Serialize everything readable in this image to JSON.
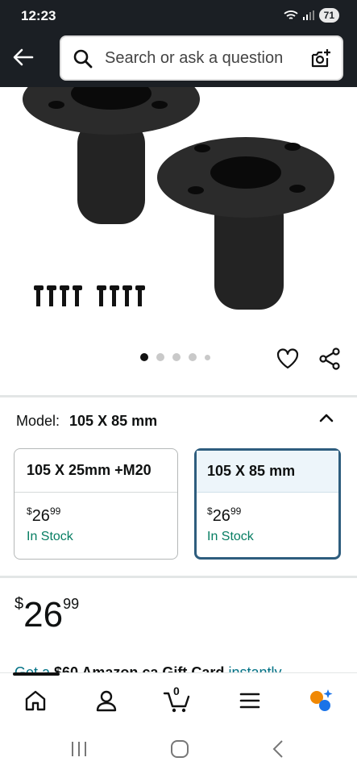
{
  "status_bar": {
    "time": "12:23",
    "battery": "71"
  },
  "search": {
    "placeholder": "Search or ask a question"
  },
  "gallery": {
    "image_count": 5,
    "active_index": 0
  },
  "variant": {
    "label": "Model:",
    "selected": "105 X 85 mm",
    "options": [
      {
        "name": "105 X 25mm +M20",
        "currency": "$",
        "price_whole": "26",
        "price_cents": "99",
        "stock": "In Stock"
      },
      {
        "name": "105 X 85 mm",
        "currency": "$",
        "price_whole": "26",
        "price_cents": "99",
        "stock": "In Stock"
      }
    ]
  },
  "price": {
    "currency": "$",
    "whole": "26",
    "cents": "99"
  },
  "promo": {
    "prefix": "Get a ",
    "amount": "$60 Amazon.ca Gift Card",
    "suffix": " instantly"
  },
  "bottom_nav": {
    "cart_count": "0"
  },
  "colors": {
    "header_bg": "#1b1f24",
    "selected_border": "#2e5d7e",
    "in_stock": "#067d62",
    "link": "#007185"
  }
}
